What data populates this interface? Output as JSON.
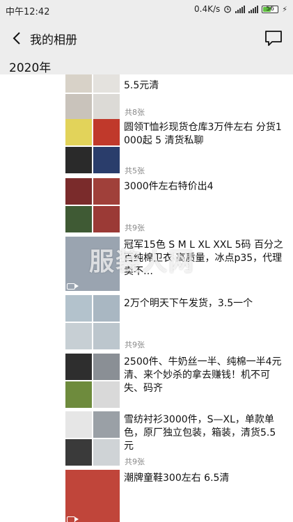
{
  "status": {
    "time": "中午12:42",
    "net_speed": "0.4K/s",
    "signal_type": "4G",
    "battery_level": "56",
    "battery_fraction": 0.56
  },
  "header": {
    "title": "我的相册",
    "back_icon": "chevron-left-icon",
    "comment_icon": "message-square-icon"
  },
  "year_label": "2020年",
  "watermark": "服装人网",
  "entries": [
    {
      "text": "5.5元清",
      "count": "共8张",
      "thumb_colors": [
        "#d8d2c8",
        "#e4e2de",
        "#c9c3bb",
        "#dcdad6"
      ],
      "video": false
    },
    {
      "text": "圆领T恤衫现货仓库3万件左右 分货1000起 5 清货私聊",
      "count": "共5张",
      "thumb_colors": [
        "#e2d35a",
        "#c0392b",
        "#2a2a2a",
        "#2a3d6b"
      ],
      "video": false
    },
    {
      "text": "3000件左右特价出4",
      "count": "共9张",
      "thumb_colors": [
        "#7a2b2b",
        "#a0403a",
        "#3f5a34",
        "#9b3a36"
      ],
      "video": false
    },
    {
      "text": "冠军15色 S M L XL XXL 5码 百分之百纯棉卫衣 高质量，冰点p35，代理卖不…",
      "count": "",
      "thumb_colors": [
        "#9aa4b0"
      ],
      "video": true
    },
    {
      "text": "2万个明天下午发货，3.5一个",
      "count": "共9张",
      "thumb_colors": [
        "#b3c2cc",
        "#a9b7c2",
        "#c7cfd4",
        "#bcc6cd"
      ],
      "video": false
    },
    {
      "text": "2500件、牛奶丝一半、纯棉一半4元清、来个妙杀的拿去赚钱！机不可失、码齐",
      "count": "",
      "thumb_colors": [
        "#2e2e2e",
        "#8a8f95",
        "#6e8b3d",
        "#d9d9d9"
      ],
      "video": false
    },
    {
      "text": "雪纺衬衫3000件，S—XL，单款单色，原厂独立包装，箱装，清货5.5元",
      "count": "共9张",
      "thumb_colors": [
        "#e6e6e6",
        "#9aa0a6",
        "#3a3a3a",
        "#cfd3d6"
      ],
      "video": false
    },
    {
      "text": "潮牌童鞋300左右 6.5清",
      "count": "",
      "thumb_colors": [
        "#c0453a"
      ],
      "video": true
    }
  ]
}
